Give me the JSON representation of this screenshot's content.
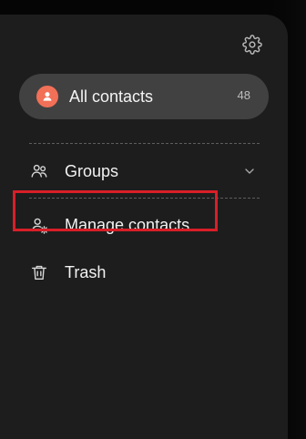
{
  "header": {
    "settings_icon": "gear-icon"
  },
  "contacts_summary": {
    "label": "All contacts",
    "count": "48",
    "avatar_icon": "person-icon",
    "avatar_color": "#f17057"
  },
  "menu": {
    "items": [
      {
        "label": "Groups",
        "icon": "groups-icon",
        "trailing_icon": "chevron-down-icon"
      },
      {
        "label": "Manage contacts",
        "icon": "manage-contacts-icon",
        "highlighted": true
      },
      {
        "label": "Trash",
        "icon": "trash-icon"
      }
    ]
  },
  "colors": {
    "drawer_background": "#1d1d1d",
    "selected_pill": "#414141",
    "highlight_outline": "#d81f28",
    "text": "#f2f2f2"
  }
}
